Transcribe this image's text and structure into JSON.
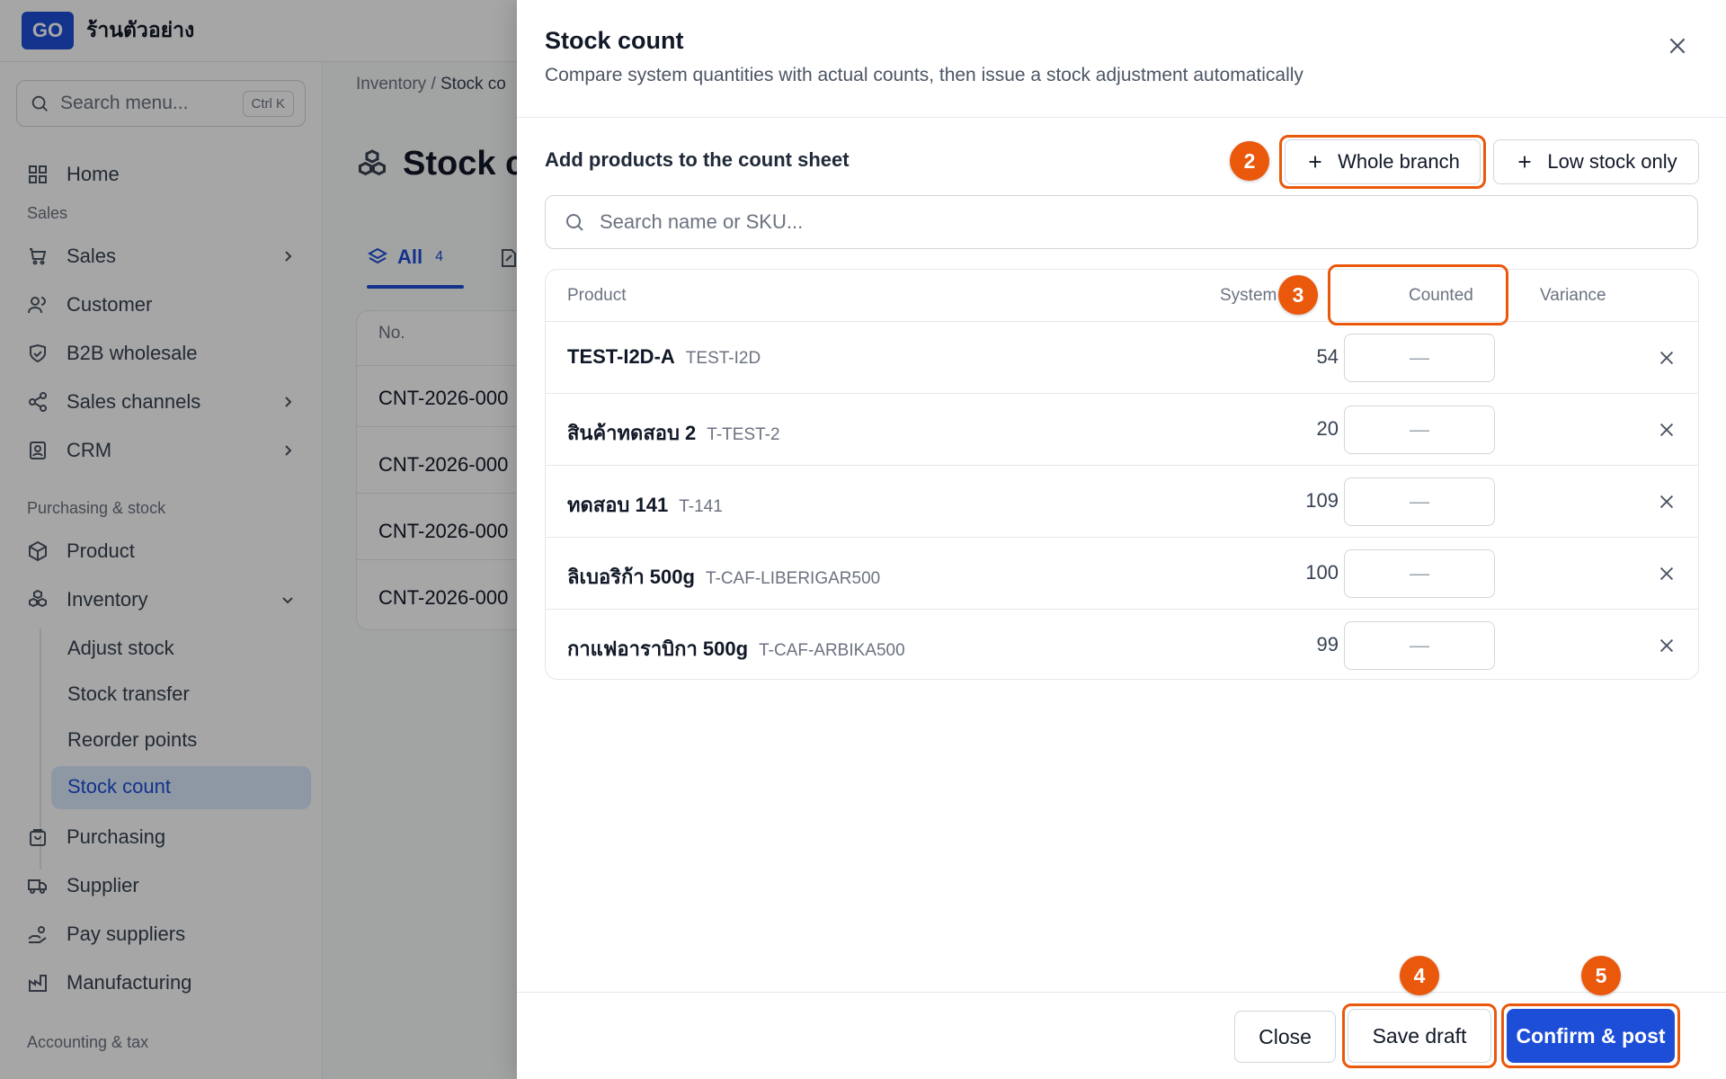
{
  "app": {
    "logo": "GO",
    "shop_name": "ร้านตัวอย่าง"
  },
  "sidebar": {
    "search_placeholder": "Search menu...",
    "search_shortcut": "Ctrl K",
    "home": "Home",
    "section_sales": "Sales",
    "sales": "Sales",
    "customer": "Customer",
    "b2b": "B2B wholesale",
    "sales_channels": "Sales channels",
    "crm": "CRM",
    "section_purchasing": "Purchasing & stock",
    "product": "Product",
    "inventory": "Inventory",
    "inventory_sub": [
      "Adjust stock",
      "Stock transfer",
      "Reorder points",
      "Stock count"
    ],
    "purchasing": "Purchasing",
    "supplier": "Supplier",
    "pay_suppliers": "Pay suppliers",
    "manufacturing": "Manufacturing",
    "section_accounting": "Accounting & tax"
  },
  "main": {
    "breadcrumb_root": "Inventory",
    "breadcrumb_sep": "/",
    "breadcrumb_current": "Stock co",
    "title": "Stock co",
    "tab_all": "All",
    "tab_all_count": "4",
    "list_header_no": "No.",
    "list_rows": [
      "CNT-2026-000",
      "CNT-2026-000",
      "CNT-2026-000",
      "CNT-2026-000"
    ]
  },
  "drawer": {
    "title": "Stock count",
    "subtitle": "Compare system quantities with actual counts, then issue a stock adjustment automatically",
    "add_label": "Add products to the count sheet",
    "whole_branch": "Whole branch",
    "low_stock_only": "Low stock only",
    "search_placeholder": "Search name or SKU...",
    "columns": {
      "product": "Product",
      "system": "System",
      "counted": "Counted",
      "variance": "Variance"
    },
    "rows": [
      {
        "name": "TEST-I2D-A",
        "sku": "TEST-I2D",
        "system": "54",
        "counted_placeholder": "—"
      },
      {
        "name": "สินค้าทดสอบ 2",
        "sku": "T-TEST-2",
        "system": "20",
        "counted_placeholder": "—"
      },
      {
        "name": "ทดสอบ 141",
        "sku": "T-141",
        "system": "109",
        "counted_placeholder": "—"
      },
      {
        "name": "ลิเบอริก้า 500g",
        "sku": "T-CAF-LIBERIGAR500",
        "system": "100",
        "counted_placeholder": "—"
      },
      {
        "name": "กาแฟอาราบิกา 500g",
        "sku": "T-CAF-ARBIKA500",
        "system": "99",
        "counted_placeholder": "—"
      }
    ],
    "close": "Close",
    "save_draft": "Save draft",
    "confirm_post": "Confirm & post"
  },
  "annotations": {
    "badge_2": "2",
    "badge_3": "3",
    "badge_4": "4",
    "badge_5": "5",
    "color": "#ea580c"
  },
  "colors": {
    "primary": "#1d4ed8",
    "highlight": "#ea580c"
  }
}
